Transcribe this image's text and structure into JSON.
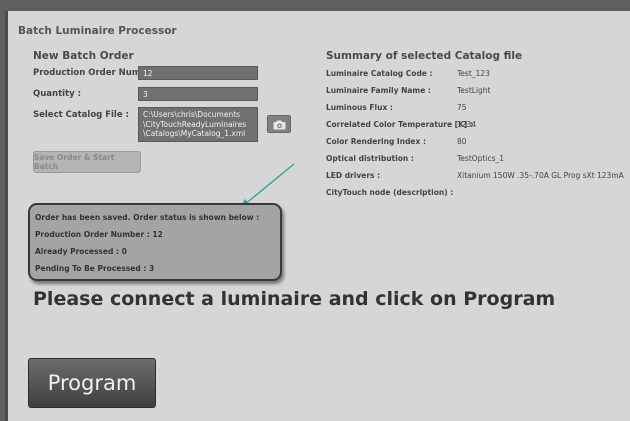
{
  "app": {
    "title": "Batch Luminaire Processor"
  },
  "order": {
    "heading": "New Batch Order",
    "production_order_label": "Production Order Number :",
    "production_order_value": "12",
    "quantity_label": "Quantity :",
    "quantity_value": "3",
    "catalog_label": "Select Catalog File :",
    "catalog_value": "C:\\Users\\chris\\Documents\n\\CityTouchReadyLuminaires\n\\Catalogs\\MyCatalog_1.xml",
    "browse_icon": "camera-icon",
    "save_button": "Save Order & Start Batch"
  },
  "status": {
    "line1": "Order has been saved.  Order status is shown below :",
    "production_order": "Production Order Number :  12",
    "processed": "Already Processed :  0",
    "pending": "Pending To Be Processed :  3"
  },
  "summary": {
    "heading": "Summary of selected Catalog file",
    "rows": [
      {
        "label": "Luminaire Catalog Code :",
        "value": "Test_123"
      },
      {
        "label": "Luminaire Family Name :",
        "value": "TestLight"
      },
      {
        "label": "Luminous Flux :",
        "value": "75"
      },
      {
        "label": "Correlated Color Temperature [K] :",
        "value": "1234"
      },
      {
        "label": "Color Rendering Index :",
        "value": "80"
      },
      {
        "label": "Optical distribution :",
        "value": "TestOptics_1"
      },
      {
        "label": "LED drivers :",
        "value": "Xitanium 150W .35-.70A GL Prog sXt   123mA"
      },
      {
        "label": "CityTouch node (description) :",
        "value": ""
      }
    ]
  },
  "instruction": "Please connect a luminaire and click on Program",
  "program_button": "Program",
  "colors": {
    "arrow": "#2ba89b",
    "background": "#d6d6d6",
    "frame": "#5f5f5f"
  }
}
